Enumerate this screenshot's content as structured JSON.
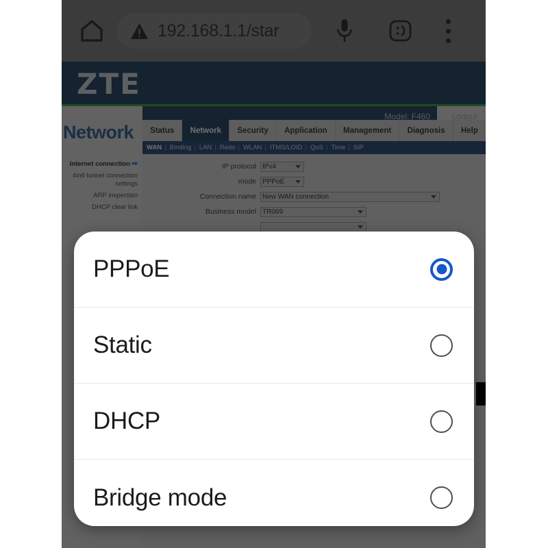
{
  "browser": {
    "home_icon": "home-icon",
    "security_icon": "warning-triangle-icon",
    "url": "192.168.1.1/star",
    "mic_icon": "microphone-icon",
    "emoji_icon": "emoji-face-icon",
    "menu_icon": "overflow-menu-icon"
  },
  "router": {
    "brand": "ZTE",
    "model": "Model: F460",
    "logout": "Logout",
    "page_title": "Network",
    "tabs": [
      {
        "label": "Status",
        "active": false
      },
      {
        "label": "Network",
        "active": true
      },
      {
        "label": "Security",
        "active": false
      },
      {
        "label": "Application",
        "active": false
      },
      {
        "label": "Management",
        "active": false
      },
      {
        "label": "Diagnosis",
        "active": false
      },
      {
        "label": "Help",
        "active": false
      }
    ],
    "subnav": [
      "WAN",
      "Binding",
      "LAN",
      "Redo",
      "WLAN",
      "ITMS/LOID",
      "QoS",
      "Time",
      "SIP"
    ],
    "sidebar": [
      {
        "label": "Internet connection",
        "active": true
      },
      {
        "label": "4in6 tunnel connection settings",
        "active": false
      },
      {
        "label": "ARP inspection",
        "active": false
      },
      {
        "label": "DHCP clear link",
        "active": false
      }
    ],
    "form": [
      {
        "label": "IP protocol",
        "value": "IPv4",
        "width": "w-sm"
      },
      {
        "label": "mode",
        "value": "PPPoE",
        "width": "w-sm"
      },
      {
        "label": "Connection name",
        "value": "New WAN connection",
        "width": "w-lg"
      },
      {
        "label": "Business model",
        "value": "TR069",
        "width": "w-md"
      }
    ],
    "help_button": "Help",
    "accent_green": "#1d9e1d",
    "header_blue": "#0d2d53"
  },
  "dialog": {
    "options": [
      {
        "label": "PPPoE",
        "selected": true
      },
      {
        "label": "Static",
        "selected": false
      },
      {
        "label": "DHCP",
        "selected": false
      },
      {
        "label": "Bridge mode",
        "selected": false
      }
    ],
    "selected_color": "#1558c8"
  }
}
